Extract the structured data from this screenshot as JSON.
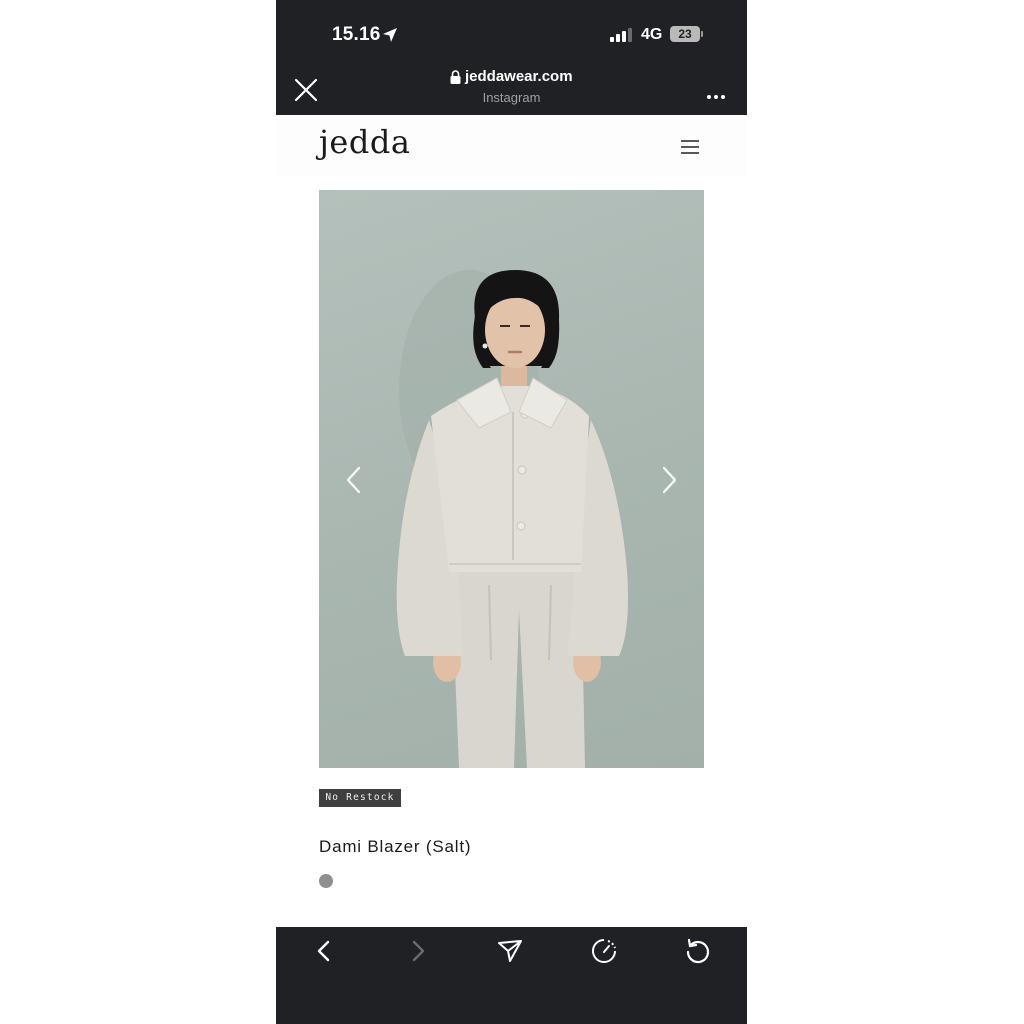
{
  "status_bar": {
    "time": "15.16",
    "network": "4G",
    "battery": "23"
  },
  "browser": {
    "domain": "jeddawear.com",
    "source": "Instagram"
  },
  "site": {
    "logo": "jedda"
  },
  "product": {
    "badge": "No Restock",
    "title": "Dami Blazer (Salt)",
    "swatch_color": "#8f8f8f"
  },
  "colors": {
    "browser_chrome": "#202124",
    "badge_bg": "#3f3f3f"
  },
  "icons": [
    "location-arrow-icon",
    "signal-icon",
    "close-icon",
    "lock-icon",
    "more-icon",
    "menu-icon",
    "chevron-left-icon",
    "chevron-right-icon",
    "back-icon",
    "forward-icon",
    "share-icon",
    "timer-icon",
    "reload-icon"
  ]
}
